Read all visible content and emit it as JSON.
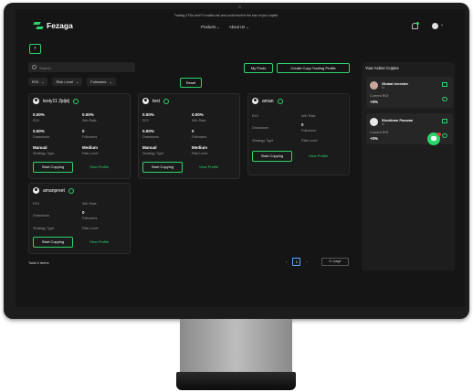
{
  "header": {
    "brand": "Fezaga",
    "disclaimer": "Trading CFDs and FX entails risk and could result in the loss of your capital.",
    "nav": [
      "Products",
      "About Us"
    ]
  },
  "toolbar": {
    "search_placeholder": "Search",
    "filters": [
      "ROI",
      "Risk Level",
      "Followers"
    ],
    "reset": "Reset",
    "my_pools": "My Pools",
    "create": "Create Copy Trading Profile"
  },
  "cards": [
    {
      "name": "testy11 2jdjdj",
      "roi": "0.00%",
      "roi_label": "ROI",
      "winrate": "0.00%",
      "winrate_label": "Win Rate",
      "drawdown": "0.00%",
      "drawdown_label": "Drawdown",
      "followers": "0",
      "followers_label": "Followers",
      "strategy": "Manual",
      "strategy_label": "Strategy Type",
      "risk": "Medium",
      "risk_label": "Risk Level",
      "start": "Start Copying",
      "view": "View Profile"
    },
    {
      "name": "test",
      "roi": "0.00%",
      "roi_label": "ROI",
      "winrate": "0.00%",
      "winrate_label": "Win Rate",
      "drawdown": "0.00%",
      "drawdown_label": "Drawdown",
      "followers": "0",
      "followers_label": "Followers",
      "strategy": "Manual",
      "strategy_label": "Strategy Type",
      "risk": "Medium",
      "risk_label": "Risk Level",
      "start": "Start Copying",
      "view": "View Profile"
    },
    {
      "name": "aman",
      "roi": "",
      "roi_label": "ROI",
      "winrate": "",
      "winrate_label": "Win Rate",
      "drawdown": "",
      "drawdown_label": "Drawdown",
      "followers": "0",
      "followers_label": "Followers",
      "strategy": "",
      "strategy_label": "Strategy Type",
      "risk": "",
      "risk_label": "Risk Level",
      "start": "Start Copying",
      "view": "View Profile"
    },
    {
      "name": "amanpreet",
      "roi": "",
      "roi_label": "ROI",
      "winrate": "",
      "winrate_label": "Win Rate",
      "drawdown": "",
      "drawdown_label": "Drawdown",
      "followers": "0",
      "followers_label": "Followers",
      "strategy": "",
      "strategy_label": "Strategy Type",
      "risk": "",
      "risk_label": "Risk Level",
      "start": "Start Copying",
      "view": "View Profile"
    }
  ],
  "footer": {
    "total": "Total 4 items",
    "page": "1",
    "per_page": "6 / page"
  },
  "active_copies": {
    "title": "Your Active Copies",
    "items": [
      {
        "name": "Global investor",
        "sub": "M",
        "roi_label": "Current ROI",
        "roi": "+0%"
      },
      {
        "name": "Shubham Paswan",
        "sub": "M",
        "roi_label": "Current ROI",
        "roi": "+0%"
      }
    ]
  }
}
